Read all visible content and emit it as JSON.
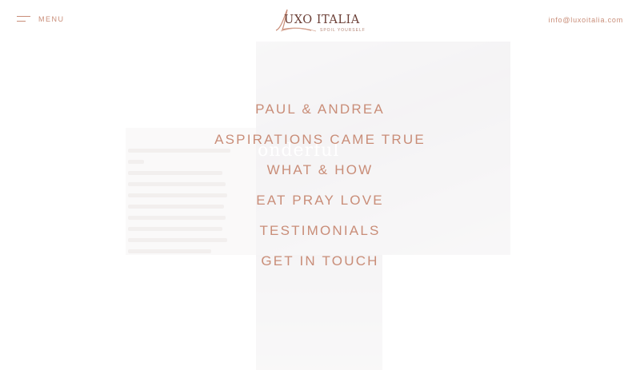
{
  "colors": {
    "accent": "#c98d78",
    "logo_dark": "#6b3f36",
    "overlay": "#ffffff"
  },
  "header": {
    "menu_label": "MENU",
    "logo_name": "UXO ITALIA",
    "logo_tagline": "SPOIL YOURSELF",
    "email": "info@luxoitalia.com"
  },
  "background": {
    "script_word": "onderful"
  },
  "nav": {
    "items": [
      {
        "label": "PAUL & ANDREA"
      },
      {
        "label": "ASPIRATIONS CAME TRUE"
      },
      {
        "label": "WHAT & HOW"
      },
      {
        "label": "EAT PRAY LOVE"
      },
      {
        "label": "TESTIMONIALS"
      },
      {
        "label": "GET IN TOUCH"
      }
    ]
  }
}
